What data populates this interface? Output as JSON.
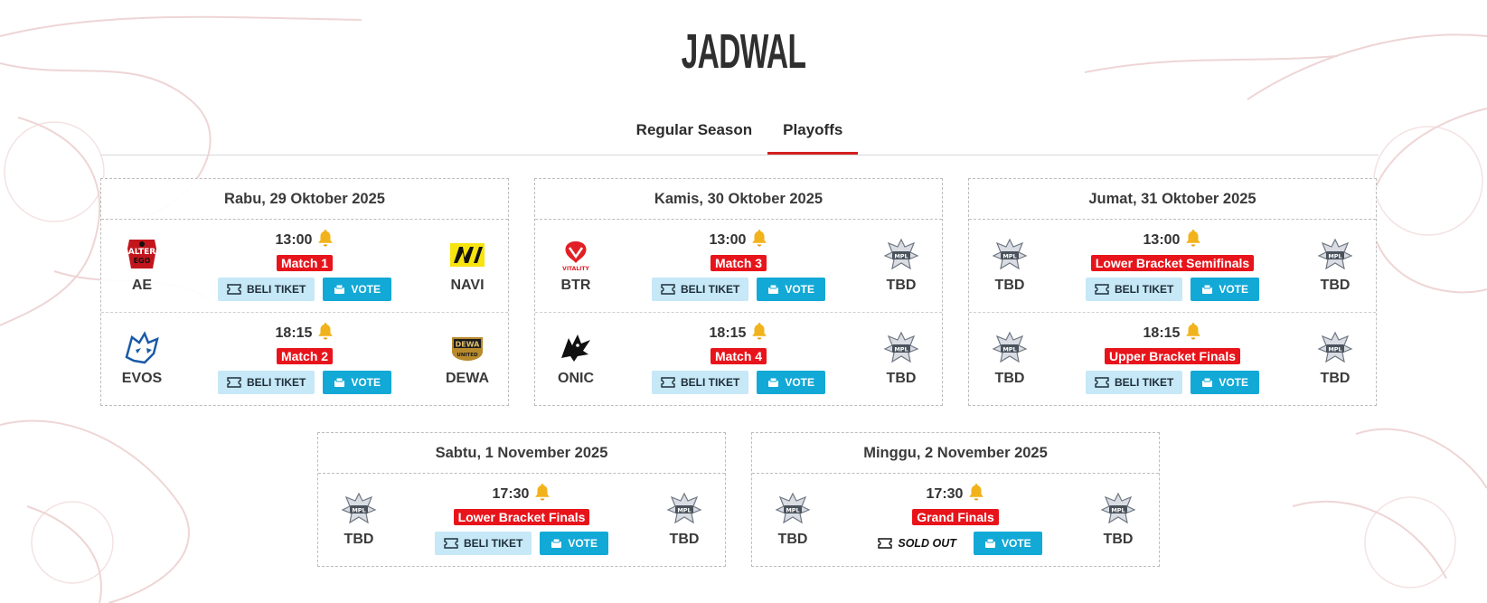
{
  "page_title": "JADWAL",
  "tabs": [
    {
      "label": "Regular Season",
      "active": false
    },
    {
      "label": "Playoffs",
      "active": true
    }
  ],
  "buttons": {
    "ticket": "BELI TIKET",
    "vote": "VOTE",
    "sold_out": "SOLD OUT"
  },
  "colors": {
    "accent_red": "#e8141b",
    "vote_blue": "#12a9d6",
    "ticket_blue": "#c6e8f7"
  },
  "days": [
    {
      "date": "Rabu, 29 Oktober 2025",
      "matches": [
        {
          "time": "13:00",
          "label": "Match 1",
          "left": {
            "name": "AE",
            "logo": "alter-ego-logo"
          },
          "right": {
            "name": "NAVI",
            "logo": "navi-logo"
          }
        },
        {
          "time": "18:15",
          "label": "Match 2",
          "left": {
            "name": "EVOS",
            "logo": "evos-logo"
          },
          "right": {
            "name": "DEWA",
            "logo": "dewa-united-logo"
          }
        }
      ]
    },
    {
      "date": "Kamis, 30 Oktober 2025",
      "matches": [
        {
          "time": "13:00",
          "label": "Match 3",
          "left": {
            "name": "BTR",
            "logo": "vitality-logo"
          },
          "right": {
            "name": "TBD",
            "logo": "mpl-logo"
          }
        },
        {
          "time": "18:15",
          "label": "Match 4",
          "left": {
            "name": "ONIC",
            "logo": "onic-logo"
          },
          "right": {
            "name": "TBD",
            "logo": "mpl-logo"
          }
        }
      ]
    },
    {
      "date": "Jumat, 31 Oktober 2025",
      "matches": [
        {
          "time": "13:00",
          "label": "Lower Bracket Semifinals",
          "left": {
            "name": "TBD",
            "logo": "mpl-logo"
          },
          "right": {
            "name": "TBD",
            "logo": "mpl-logo"
          }
        },
        {
          "time": "18:15",
          "label": "Upper Bracket Finals",
          "left": {
            "name": "TBD",
            "logo": "mpl-logo"
          },
          "right": {
            "name": "TBD",
            "logo": "mpl-logo"
          }
        }
      ]
    },
    {
      "date": "Sabtu, 1 November 2025",
      "matches": [
        {
          "time": "17:30",
          "label": "Lower Bracket Finals",
          "left": {
            "name": "TBD",
            "logo": "mpl-logo"
          },
          "right": {
            "name": "TBD",
            "logo": "mpl-logo"
          }
        }
      ]
    },
    {
      "date": "Minggu, 2 November 2025",
      "sold_out": true,
      "matches": [
        {
          "time": "17:30",
          "label": "Grand Finals",
          "left": {
            "name": "TBD",
            "logo": "mpl-logo"
          },
          "right": {
            "name": "TBD",
            "logo": "mpl-logo"
          }
        }
      ]
    }
  ]
}
